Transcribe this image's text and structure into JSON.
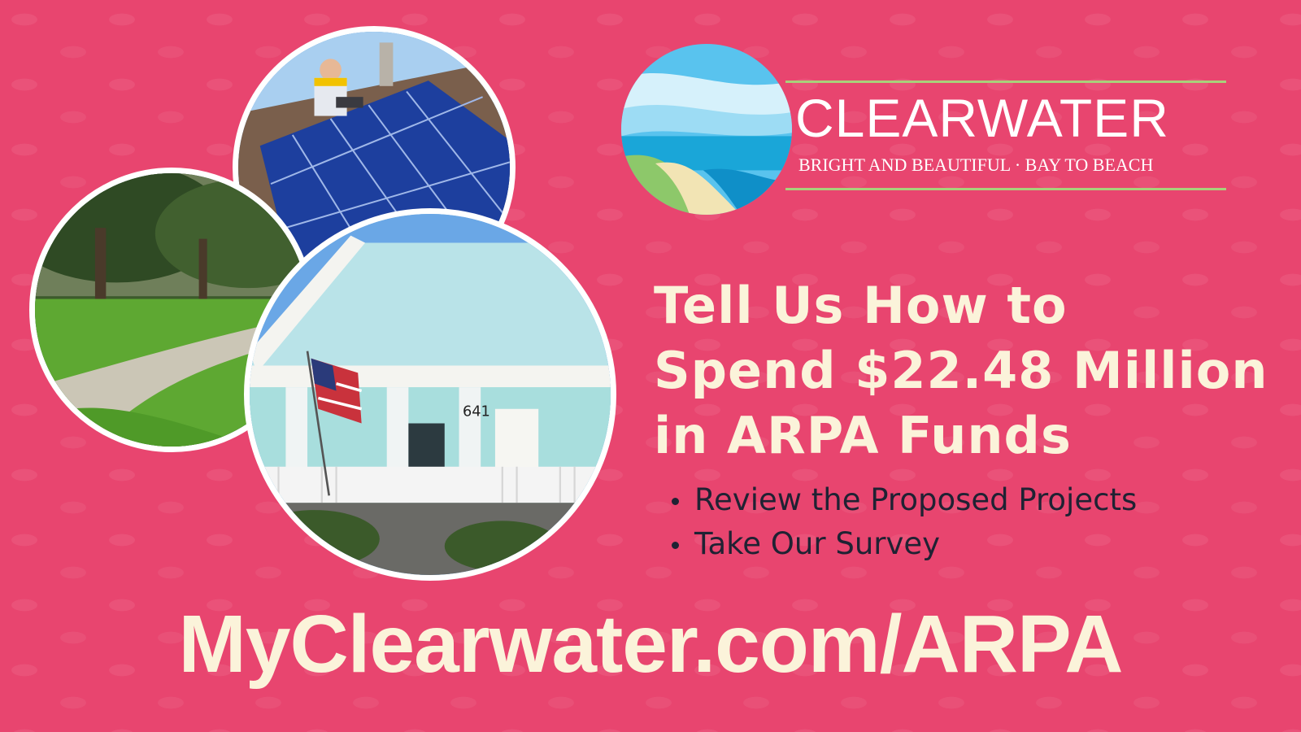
{
  "logo": {
    "name": "CLEARWATER",
    "tagline": "BRIGHT AND BEAUTIFUL · BAY TO BEACH"
  },
  "headline": {
    "lines": [
      "Tell Us How to",
      "Spend $22.48 Million",
      "in ARPA Funds"
    ]
  },
  "bullets": [
    "Review the Proposed Projects",
    "Take Our Survey"
  ],
  "url": "MyClearwater.com/ARPA",
  "photos": {
    "top": "solar-panel-installation",
    "left": "park-walkway",
    "center": "blue-house-porch",
    "house_number": "641"
  },
  "colors": {
    "background": "#e8456f",
    "headline_text": "#fbf3da",
    "bullet_text": "#1f2233",
    "logo_accent": "#a9d07a"
  }
}
